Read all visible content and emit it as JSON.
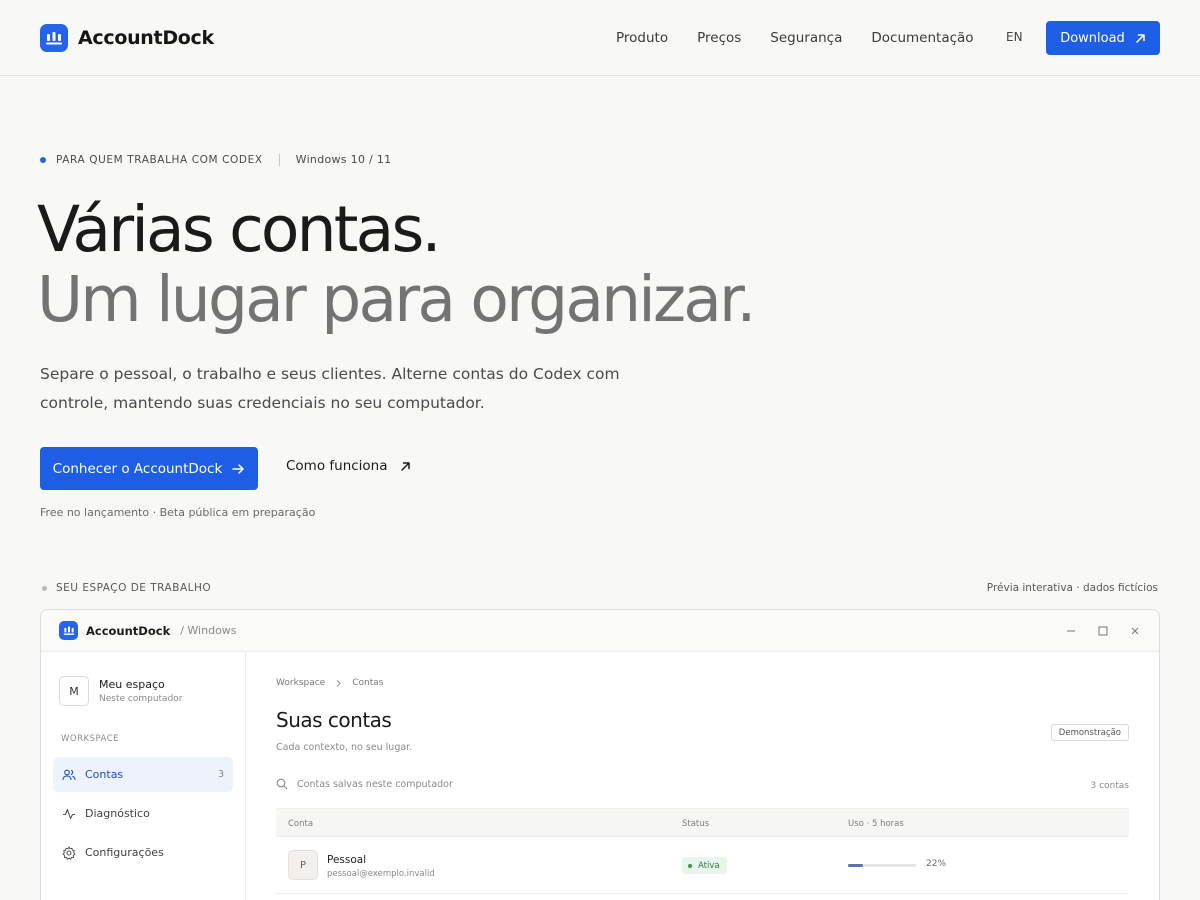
{
  "header": {
    "brand": "AccountDock",
    "nav": [
      "Produto",
      "Preços",
      "Segurança",
      "Documentação"
    ],
    "lang": "EN",
    "download_label": "Download"
  },
  "hero": {
    "eyebrow": "PARA QUEM TRABALHA COM CODEX",
    "os": "Windows 10 / 11",
    "headline_1": "Várias contas.",
    "headline_2": "Um lugar para organizar.",
    "lead": "Separe o pessoal, o trabalho e seus clientes. Alterne contas do Codex com controle, mantendo suas credenciais no seu computador.",
    "cta_primary": "Conhecer o AccountDock",
    "cta_secondary": "Como funciona",
    "note": "Free no lançamento · Beta pública em preparação"
  },
  "preview": {
    "section_label": "SEU ESPAÇO DE TRABALHO",
    "section_note": "Prévia interativa · dados fictícios",
    "window": {
      "title": "AccountDock",
      "subtitle": "/ Windows"
    },
    "sidebar": {
      "space_initial": "M",
      "space_name": "Meu espaço",
      "space_sub": "Neste computador",
      "group": "WORKSPACE",
      "items": [
        {
          "label": "Contas",
          "count": "3",
          "icon": "users-icon"
        },
        {
          "label": "Diagnóstico",
          "icon": "activity-icon"
        },
        {
          "label": "Configurações",
          "icon": "gear-icon"
        }
      ]
    },
    "main": {
      "breadcrumb": [
        "Workspace",
        "Contas"
      ],
      "title": "Suas contas",
      "subtitle": "Cada contexto, no seu lugar.",
      "badge": "Demonstração",
      "search_placeholder": "Contas salvas neste computador",
      "count": "3 contas",
      "columns": [
        "Conta",
        "Status",
        "Uso · 5 horas"
      ],
      "rows": [
        {
          "initial": "P",
          "name": "Pessoal",
          "email": "pessoal@exemplo.invalid",
          "status": "Ativa",
          "usage": "22%",
          "usage_fraction": 0.22
        }
      ]
    }
  },
  "colors": {
    "accent": "#1e5ee6",
    "status_active": "#2f7a44"
  }
}
